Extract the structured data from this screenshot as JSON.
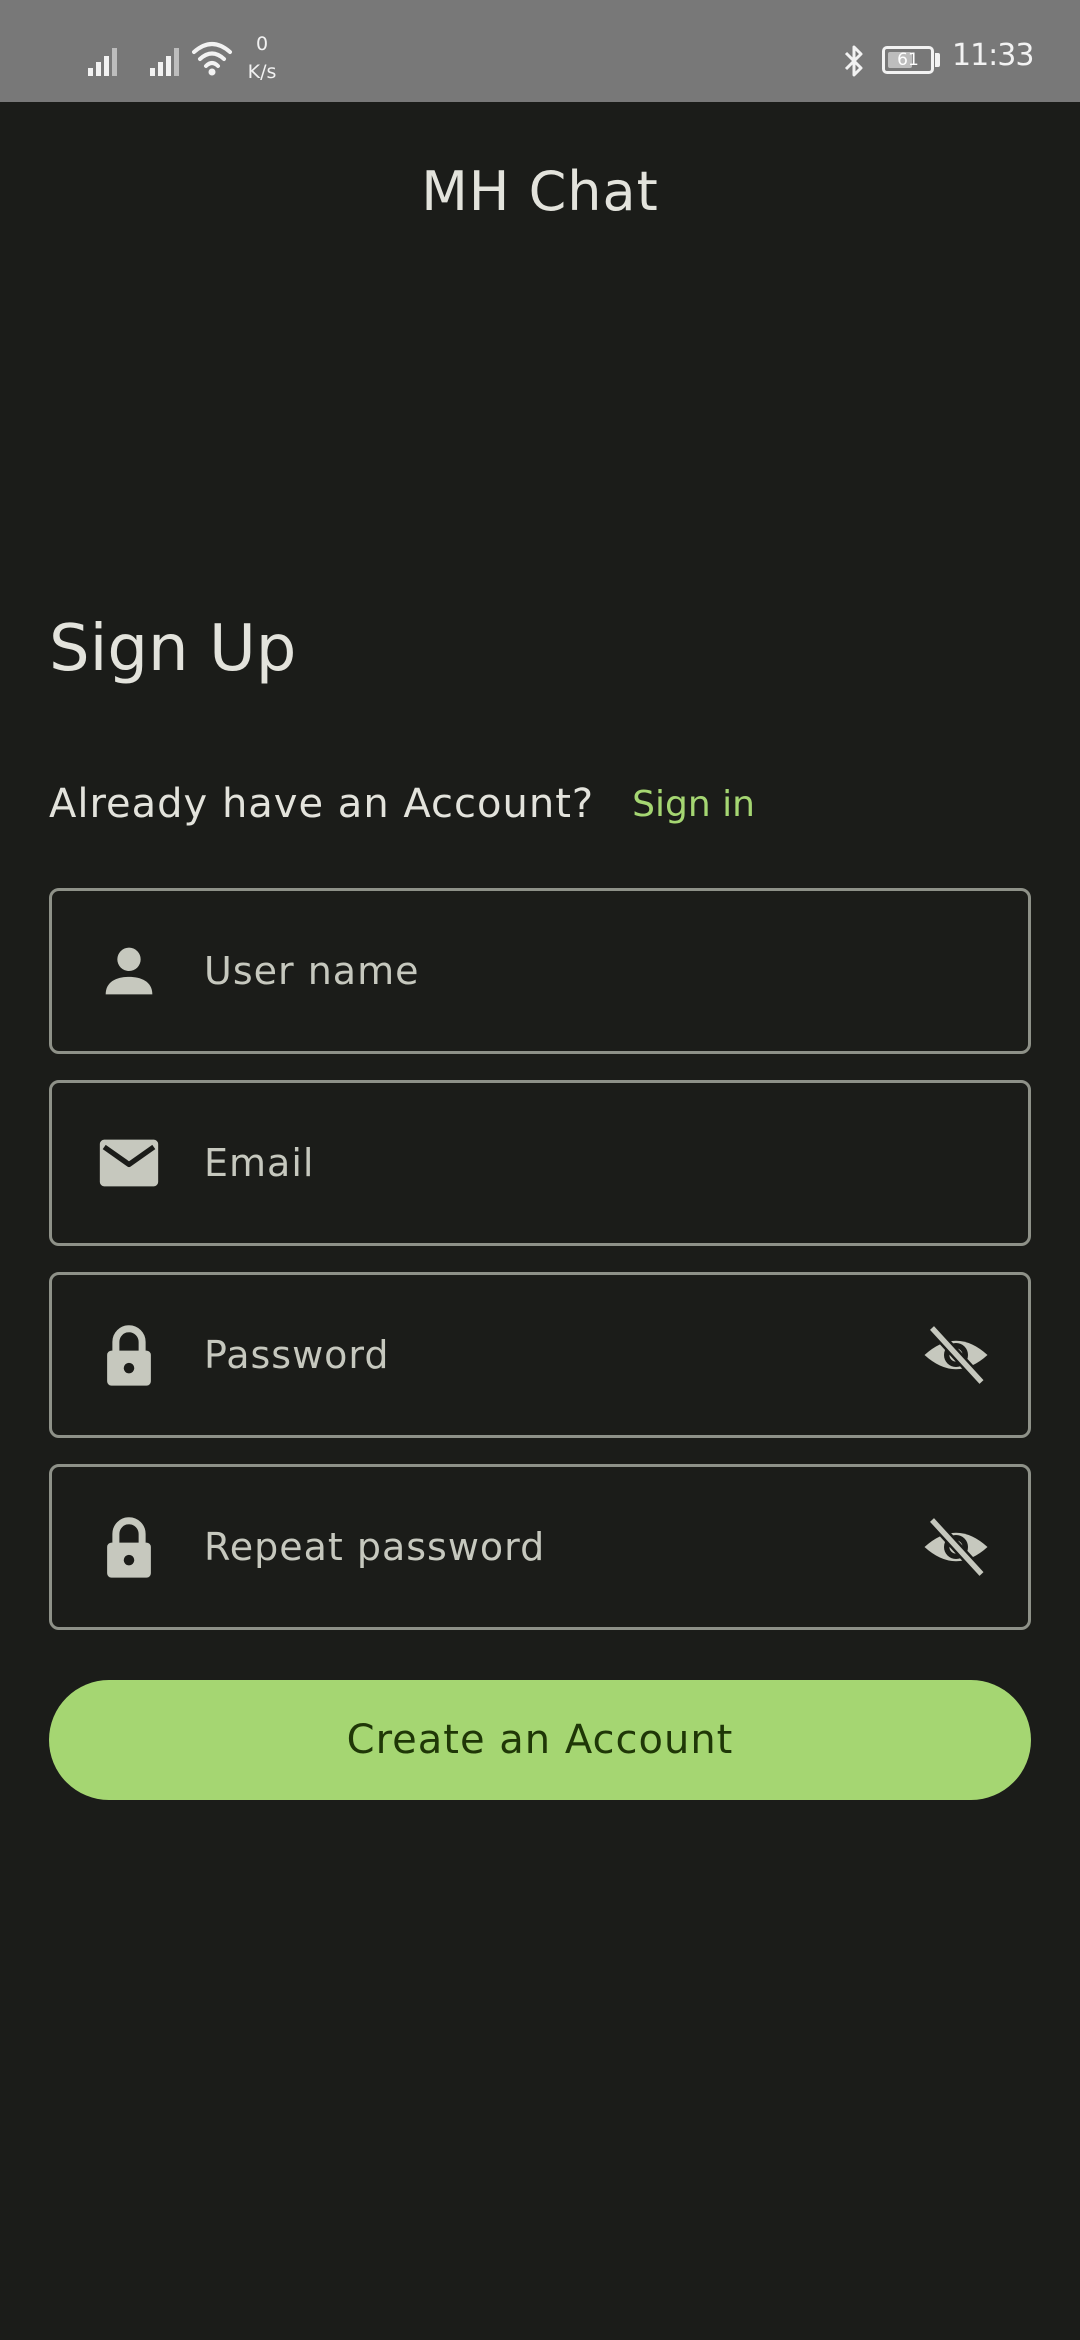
{
  "status_bar": {
    "net_speed_value": "0",
    "net_speed_unit": "K/s",
    "battery_level": "61",
    "time": "11:33",
    "icons": [
      "signal-icon",
      "signal-icon",
      "wifi-icon",
      "bluetooth-icon",
      "battery-icon"
    ]
  },
  "app": {
    "title": "MH Chat"
  },
  "screen": {
    "heading": "Sign Up",
    "account_prompt": "Already have an Account?",
    "signin_link": "Sign in"
  },
  "form": {
    "username": {
      "placeholder": "User name",
      "value": "",
      "icon": "person-icon"
    },
    "email": {
      "placeholder": "Email",
      "value": "",
      "icon": "mail-icon"
    },
    "password": {
      "placeholder": "Password",
      "value": "",
      "icon": "lock-icon",
      "toggle_icon": "eye-off-icon"
    },
    "repeat_password": {
      "placeholder": "Repeat password",
      "value": "",
      "icon": "lock-icon",
      "toggle_icon": "eye-off-icon"
    },
    "submit_label": "Create an Account"
  },
  "colors": {
    "background": "#1b1c19",
    "accent": "#a5d672",
    "text": "#e3e3dc",
    "outline": "#8e9188",
    "status_bar": "#787878"
  }
}
